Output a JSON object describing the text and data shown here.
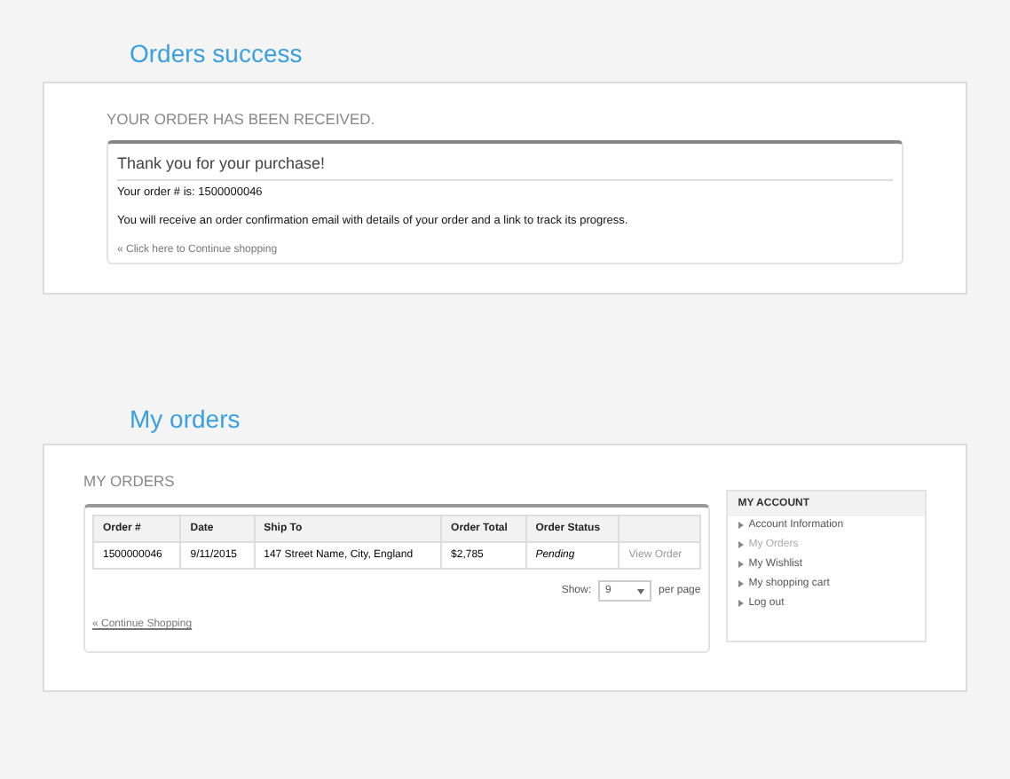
{
  "success": {
    "title": "Orders success",
    "heading": "YOUR ORDER HAS BEEN RECEIVED.",
    "thanks": "Thank you for your purchase!",
    "order_line": "Your order # is: 1500000046",
    "message": "You will receive an order confirmation email with details of your order and a link to track its progress.",
    "continue_link": "« Click here to Continue shopping"
  },
  "orders": {
    "title": "My orders",
    "heading": "MY ORDERS",
    "table": {
      "columns": [
        "Order #",
        "Date",
        "Ship To",
        "Order Total",
        "Order Status"
      ],
      "rows": [
        {
          "cells": [
            "1500000046",
            "9/11/2015",
            "147 Street Name, City, England",
            "$2,785",
            "Pending",
            "View Order"
          ]
        }
      ]
    },
    "pager": {
      "label": "Show:",
      "value": "9",
      "suffix": "per page"
    },
    "continue_link": "« Continue Shopping"
  },
  "sidebar": {
    "title": "MY ACCOUNT",
    "items": [
      {
        "label": "Account Information",
        "selected": false
      },
      {
        "label": "My Orders",
        "selected": true
      },
      {
        "label": "My Wishlist",
        "selected": false
      },
      {
        "label": "My shopping cart",
        "selected": false
      },
      {
        "label": "Log out",
        "selected": false
      }
    ]
  }
}
